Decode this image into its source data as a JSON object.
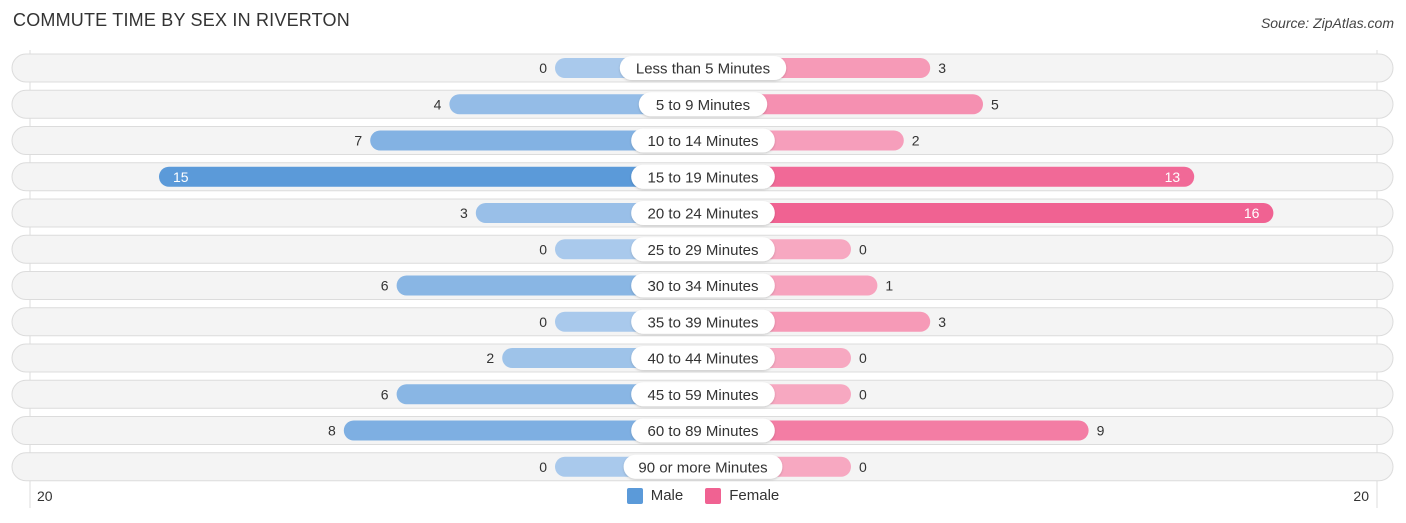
{
  "header": {
    "title": "COMMUTE TIME BY SEX IN RIVERTON",
    "source": "Source: ZipAtlas.com"
  },
  "colors": {
    "male": "#5b9ad9",
    "male_light": "#a9c9ec",
    "female": "#f06292",
    "female_light": "#f7a8c1"
  },
  "chart_data": {
    "type": "bar",
    "orientation": "horizontal-diverging",
    "title": "COMMUTE TIME BY SEX IN RIVERTON",
    "categories": [
      "Less than 5 Minutes",
      "5 to 9 Minutes",
      "10 to 14 Minutes",
      "15 to 19 Minutes",
      "20 to 24 Minutes",
      "25 to 29 Minutes",
      "30 to 34 Minutes",
      "35 to 39 Minutes",
      "40 to 44 Minutes",
      "45 to 59 Minutes",
      "60 to 89 Minutes",
      "90 or more Minutes"
    ],
    "series": [
      {
        "name": "Male",
        "values": [
          0,
          4,
          7,
          15,
          3,
          0,
          6,
          0,
          2,
          6,
          8,
          0
        ]
      },
      {
        "name": "Female",
        "values": [
          3,
          5,
          2,
          13,
          16,
          0,
          1,
          3,
          0,
          0,
          9,
          0
        ]
      }
    ],
    "axis": {
      "left_label": "20",
      "right_label": "20",
      "max": 20
    },
    "legend": {
      "position": "bottom-center",
      "items": [
        "Male",
        "Female"
      ]
    }
  }
}
